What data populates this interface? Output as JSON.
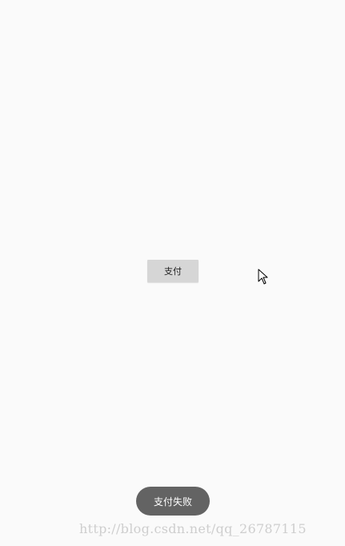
{
  "main": {
    "pay_button_label": "支付"
  },
  "toast": {
    "message": "支付失败"
  },
  "watermark": {
    "text": "http://blog.csdn.net/qq_26787115"
  },
  "colors": {
    "background": "#fafafa",
    "button_background": "#d6d6d6",
    "toast_background": "#636363",
    "toast_text": "#ffffff"
  },
  "icons": {
    "cursor": "mouse-pointer-icon"
  }
}
